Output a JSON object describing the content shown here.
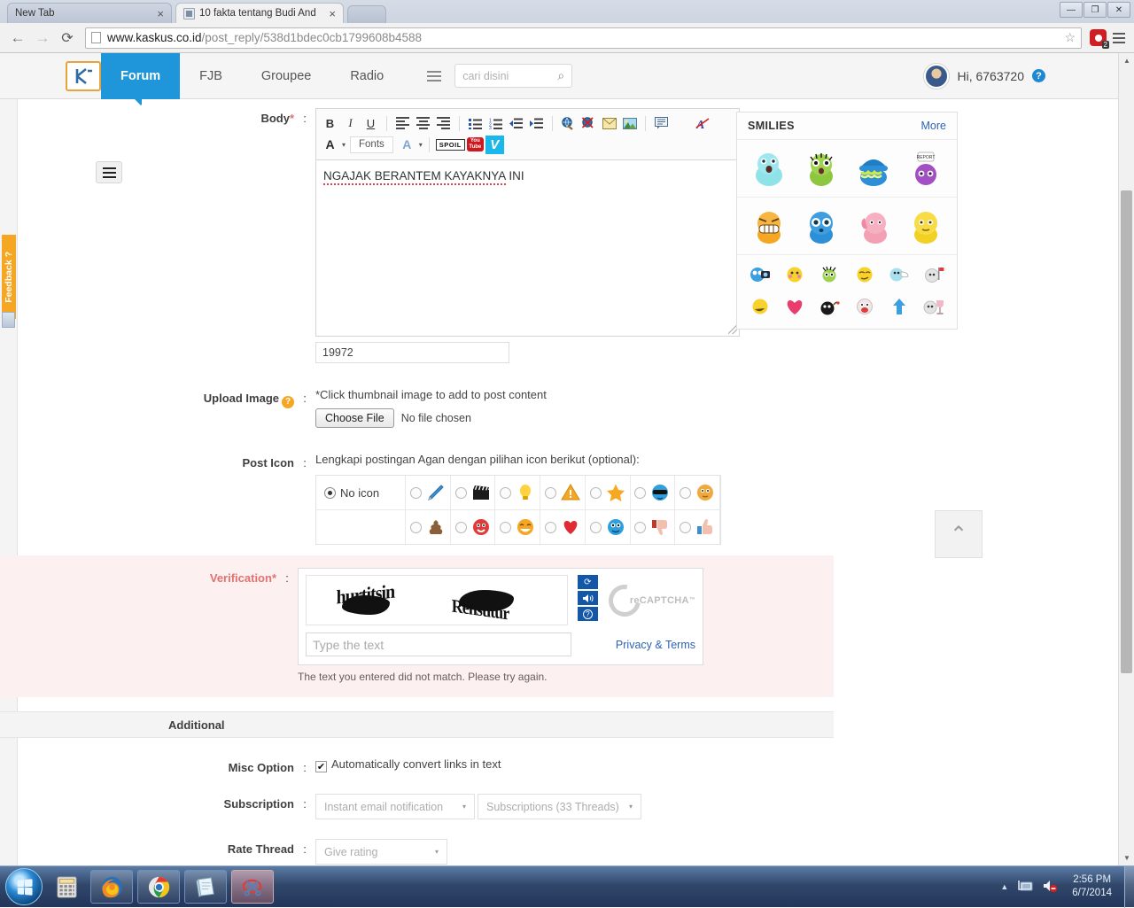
{
  "browser": {
    "tabs": [
      {
        "title": "New Tab",
        "active": false,
        "has_favicon": false
      },
      {
        "title": "10 fakta tentang Budi And",
        "active": true,
        "has_favicon": true
      }
    ],
    "close_glyph": "×",
    "back_glyph": "←",
    "forward_glyph": "→",
    "reload_glyph": "⟳",
    "url_host": "www.kaskus.co.id",
    "url_path": "/post_reply/538d1bdec0cb1799608b4588",
    "star_glyph": "☆",
    "extension_badge": "2",
    "window_controls": {
      "minimize": "—",
      "restore": "❐",
      "close": "✕"
    }
  },
  "site_header": {
    "logo_text": "K",
    "nav": [
      {
        "label": "Forum",
        "active": true
      },
      {
        "label": "FJB",
        "active": false
      },
      {
        "label": "Groupee",
        "active": false
      },
      {
        "label": "Radio",
        "active": false
      }
    ],
    "search_placeholder": "cari disini",
    "search_icon_glyph": "⌕",
    "user_greeting": "Hi, 6763720",
    "help_glyph": "?"
  },
  "sidebar": {
    "feedback_label": "Feedback ?"
  },
  "form": {
    "body": {
      "label": "Body",
      "required_mark": "*",
      "colon": ":",
      "content_spellchecked": "NGAJAK BERANTEM KAYAKNYA",
      "content_tail": " INI",
      "char_count": "19972"
    },
    "toolbar": {
      "bold": "B",
      "italic": "I",
      "underline": "U",
      "fonts_label": "Fonts",
      "spoiler_label": "SPOIL",
      "youtube_label_top": "You",
      "youtube_label_bottom": "Tube",
      "vimeo_label": "V",
      "hash_label": "#",
      "color_a": "A",
      "strike_a": "A",
      "caret_glyph": "▾"
    },
    "upload": {
      "label": "Upload Image",
      "help_glyph": "?",
      "colon": ":",
      "hint": "*Click thumbnail image to add to post content",
      "choose_button": "Choose File",
      "no_file_text": "No file chosen"
    },
    "post_icon": {
      "label": "Post Icon",
      "colon": ":",
      "hint": "Lengkapi postingan Agan dengan pilihan icon berikut (optional):",
      "no_icon_label": "No icon",
      "row1": [
        "pencil-icon",
        "clapperboard-icon",
        "lightbulb-icon",
        "warning-icon",
        "star-icon",
        "sunglasses-face-icon",
        "shy-face-icon"
      ],
      "row2": [
        "poop-icon",
        "clown-face-icon",
        "laughing-face-icon",
        "heart-icon",
        "crying-face-icon",
        "thumbs-down-icon",
        "thumbs-up-icon"
      ]
    },
    "verification": {
      "label": "Verification",
      "required_mark": "*",
      "colon": ":",
      "captcha_word_1": "hurtitsin",
      "captcha_word_2": "Renstitur",
      "input_placeholder": "Type the text",
      "privacy_link": "Privacy & Terms",
      "recaptcha_brand": "reCAPTCHA",
      "recaptcha_tm": "™",
      "error_text": "The text you entered did not match. Please try again.",
      "refresh_glyph": "⟳",
      "audio_glyph": "🔈",
      "help_glyph": "?"
    },
    "additional": {
      "section_title": "Additional",
      "misc_label": "Misc Option",
      "misc_colon": ":",
      "misc_checkbox_checked": true,
      "misc_check_glyph": "✔",
      "misc_text": "Automatically convert links in text",
      "subscription_label": "Subscription",
      "subscription_colon": ":",
      "subscription_value": "Instant email notification",
      "subscriptions_value": "Subscriptions (33 Threads)",
      "rate_label": "Rate Thread",
      "rate_colon": ":",
      "rate_value": "Give rating",
      "caret_glyph": "▾"
    }
  },
  "smilies": {
    "title": "SMILIES",
    "more_label": "More",
    "big": [
      {
        "name": "blue-shocked-icon"
      },
      {
        "name": "green-alien-icon"
      },
      {
        "name": "blue-hat-icon"
      },
      {
        "name": "purple-report-icon",
        "badge": "REPORT"
      }
    ],
    "big2": [
      {
        "name": "orange-grin-icon"
      },
      {
        "name": "blue-wondering-icon"
      },
      {
        "name": "pink-elephant-icon"
      },
      {
        "name": "yellow-sad-icon"
      }
    ],
    "small1": [
      "blue-camera-icon",
      "yellow-blush-icon",
      "green-bug-icon",
      "yellow-smirk-icon",
      "blue-sleep-icon",
      "grey-flag-icon"
    ],
    "small2": [
      "yellow-eat-icon",
      "pink-heart-icon",
      "black-bomb-icon",
      "red-angry-icon",
      "blue-arrow-up-icon",
      "grey-trophy-icon"
    ]
  },
  "scroll_to_top_glyph": "⌃",
  "scrollbar": {
    "up_glyph": "▲",
    "down_glyph": "▼"
  },
  "taskbar": {
    "items": [
      {
        "name": "calculator-icon",
        "pinned": false
      },
      {
        "name": "firefox-icon",
        "pinned": true
      },
      {
        "name": "chrome-icon",
        "pinned": true
      },
      {
        "name": "notepad-icon",
        "pinned": true
      },
      {
        "name": "snipping-tool-icon",
        "pinned": true,
        "active": true
      }
    ],
    "tray_up_glyph": "▲",
    "network_icon": "network-icon",
    "volume_icon": "volume-muted-icon",
    "time": "2:56 PM",
    "date": "6/7/2014"
  }
}
